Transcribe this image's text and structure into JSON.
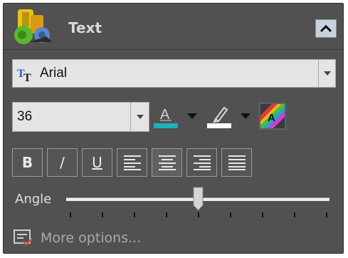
{
  "panel": {
    "title": "Text",
    "logo_icon": "text-effects-logo",
    "collapse_icon": "chevron-up-icon"
  },
  "font": {
    "name": "Arial",
    "icon": "truetype-font-icon"
  },
  "size": {
    "value": "36"
  },
  "color_controls": {
    "font_color_icon": "font-color-icon",
    "font_color_hex": "#1fb1ba",
    "highlight_icon": "highlighter-icon",
    "highlight_color_hex": "#ffffff",
    "effects_icon": "rainbow-text-effect-icon"
  },
  "style_buttons": {
    "bold": "B",
    "italic": "/",
    "underline": "U"
  },
  "alignment_buttons": [
    "align-left",
    "align-center",
    "align-right",
    "align-justify"
  ],
  "angle": {
    "label": "Angle",
    "value_fraction": 0.5,
    "tick_count": 9
  },
  "more": {
    "label": "More options...",
    "icon": "options-list-icon"
  }
}
